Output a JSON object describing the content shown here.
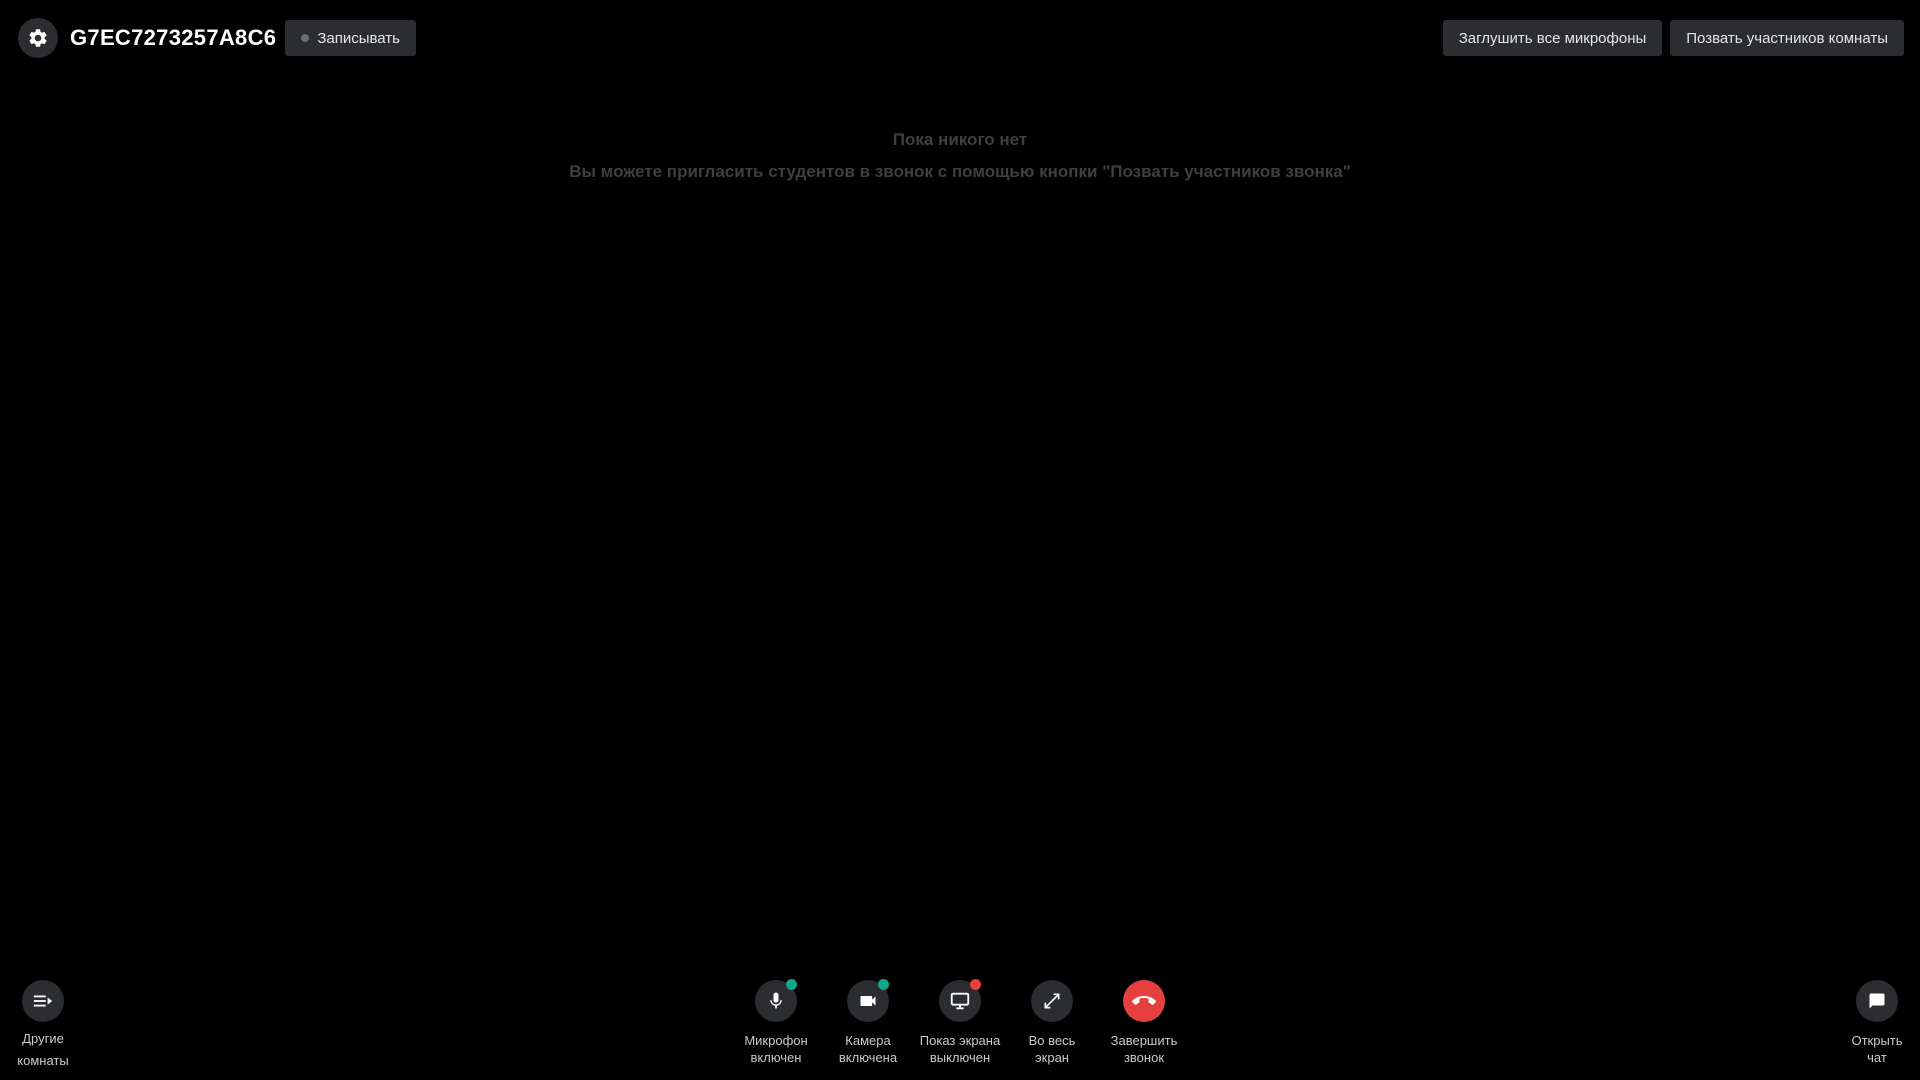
{
  "header": {
    "room_code": "G7EC7273257A8C6",
    "record_label": "Записывать",
    "mute_all_label": "Заглушить все микрофоны",
    "invite_label": "Позвать участников комнаты"
  },
  "empty_state": {
    "title": "Пока никого нет",
    "subtitle": "Вы можете пригласить студентов в звонок с помощью кнопки \"Позвать участников звонка\""
  },
  "controls": {
    "other_rooms": {
      "label": "Другие\nкомнаты",
      "icon": "playlist-icon"
    },
    "microphone": {
      "label": "Микрофон\nвключен",
      "icon": "microphone-icon",
      "status": "on"
    },
    "camera": {
      "label": "Камера\nвключена",
      "icon": "video-camera-icon",
      "status": "on"
    },
    "screen_share": {
      "label": "Показ экрана\nвыключен",
      "icon": "monitor-icon",
      "status": "off"
    },
    "fullscreen": {
      "label": "Во весь\nэкран",
      "icon": "expand-icon"
    },
    "end_call": {
      "label": "Завершить\nзвонок",
      "icon": "hang-up-icon"
    },
    "chat": {
      "label": "Открыть\nчат",
      "icon": "chat-bubble-icon"
    }
  },
  "colors": {
    "background": "#000000",
    "button_bg": "#2b2d31",
    "status_on": "#12a58a",
    "status_off": "#e5403d",
    "end_call": "#e5403d",
    "empty_text": "#3d3f43"
  }
}
